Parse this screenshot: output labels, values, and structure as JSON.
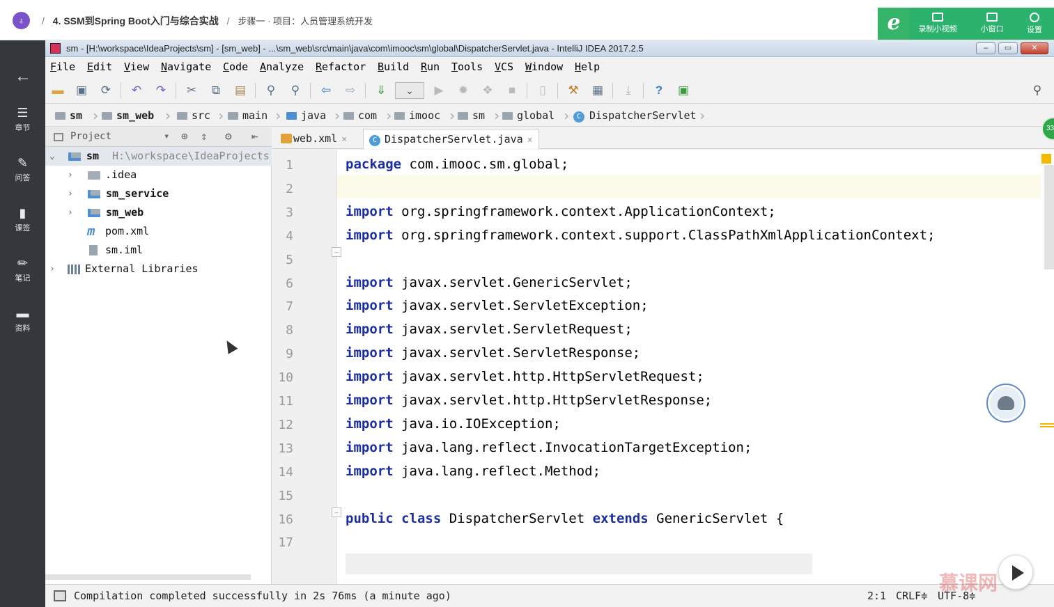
{
  "course_header": {
    "logo": "♁",
    "sep1": "/",
    "chapter": "4. SSM到Spring Boot入门与综合实战",
    "sep2": "/",
    "step": "步骤一 · 项目：人员管理系统开发",
    "ie_logo": "e",
    "tools": [
      {
        "label": "录制小视频",
        "icon": "record-video-icon"
      },
      {
        "label": "小窗口",
        "icon": "small-window-icon"
      },
      {
        "label": "设置",
        "icon": "settings-gear-icon"
      }
    ]
  },
  "course_sidebar": {
    "back": "←",
    "items": [
      {
        "label": "章节",
        "icon": "chapter-list-icon",
        "glyph": "☰"
      },
      {
        "label": "问答",
        "icon": "qa-pen-icon",
        "glyph": "✎"
      },
      {
        "label": "课签",
        "icon": "bookmark-icon",
        "glyph": "▮"
      },
      {
        "label": "笔记",
        "icon": "note-edit-icon",
        "glyph": "✏"
      },
      {
        "label": "资料",
        "icon": "folder-icon",
        "glyph": "▬"
      }
    ]
  },
  "ide": {
    "title": "sm - [H:\\workspace\\IdeaProjects\\sm] - [sm_web] - ...\\sm_web\\src\\main\\java\\com\\imooc\\sm\\global\\DispatcherServlet.java - IntelliJ IDEA 2017.2.5",
    "window_buttons": {
      "minimize": "–",
      "maximize": "▭",
      "close": "✕"
    },
    "menu": [
      "File",
      "Edit",
      "View",
      "Navigate",
      "Code",
      "Analyze",
      "Refactor",
      "Build",
      "Run",
      "Tools",
      "VCS",
      "Window",
      "Help"
    ],
    "run_config_arrow": "⌄",
    "breadcrumbs": [
      "sm",
      "sm_web",
      "src",
      "main",
      "java",
      "com",
      "imooc",
      "sm",
      "global",
      "DispatcherServlet"
    ],
    "breadcrumb_sep": "›",
    "project_panel": {
      "title": "Project",
      "dropdown_arrow": "▾",
      "tree": [
        {
          "arrow": "⌄",
          "name": "sm",
          "path": "H:\\workspace\\IdeaProjects"
        },
        {
          "arrow": "›",
          "name": ".idea"
        },
        {
          "arrow": "›",
          "name": "sm_service"
        },
        {
          "arrow": "›",
          "name": "sm_web"
        },
        {
          "prefix": "m",
          "name": "pom.xml"
        },
        {
          "name": "sm.iml"
        },
        {
          "arrow": "›",
          "name": "External Libraries"
        }
      ]
    },
    "tabs": [
      {
        "label": "web.xml",
        "close": "×"
      },
      {
        "label": "DispatcherServlet.java",
        "close": "×"
      }
    ],
    "class_icon_letter": "C",
    "fold_marker": "–",
    "code_lines": [
      {
        "no": "1",
        "kw": "package",
        "text": " com.imooc.sm.global;"
      },
      {
        "no": "2",
        "kw": "",
        "text": ""
      },
      {
        "no": "3",
        "kw": "import",
        "text": " org.springframework.context.ApplicationContext;"
      },
      {
        "no": "4",
        "kw": "import",
        "text": " org.springframework.context.support.ClassPathXmlApplicationContext;"
      },
      {
        "no": "5",
        "kw": "",
        "text": ""
      },
      {
        "no": "6",
        "kw": "import",
        "text": " javax.servlet.GenericServlet;"
      },
      {
        "no": "7",
        "kw": "import",
        "text": " javax.servlet.ServletException;"
      },
      {
        "no": "8",
        "kw": "import",
        "text": " javax.servlet.ServletRequest;"
      },
      {
        "no": "9",
        "kw": "import",
        "text": " javax.servlet.ServletResponse;"
      },
      {
        "no": "10",
        "kw": "import",
        "text": " javax.servlet.http.HttpServletRequest;"
      },
      {
        "no": "11",
        "kw": "import",
        "text": " javax.servlet.http.HttpServletResponse;"
      },
      {
        "no": "12",
        "kw": "import",
        "text": " java.io.IOException;"
      },
      {
        "no": "13",
        "kw": "import",
        "text": " java.lang.reflect.InvocationTargetException;"
      },
      {
        "no": "14",
        "kw": "import",
        "text": " java.lang.reflect.Method;"
      },
      {
        "no": "15",
        "kw": "",
        "text": ""
      },
      {
        "no": "16",
        "kw": "public class",
        "text": " DispatcherServlet ",
        "kw2": "extends",
        "text2": " GenericServlet {"
      },
      {
        "no": "17",
        "kw": "",
        "text": ""
      }
    ],
    "status": {
      "message": "Compilation completed successfully in 2s 76ms (a minute ago)",
      "position": "2:1",
      "line_sep": "CRLF≑",
      "encoding": "UTF-8≑"
    }
  },
  "overlays": {
    "badge_text": "33",
    "watermark": "慕课网"
  }
}
